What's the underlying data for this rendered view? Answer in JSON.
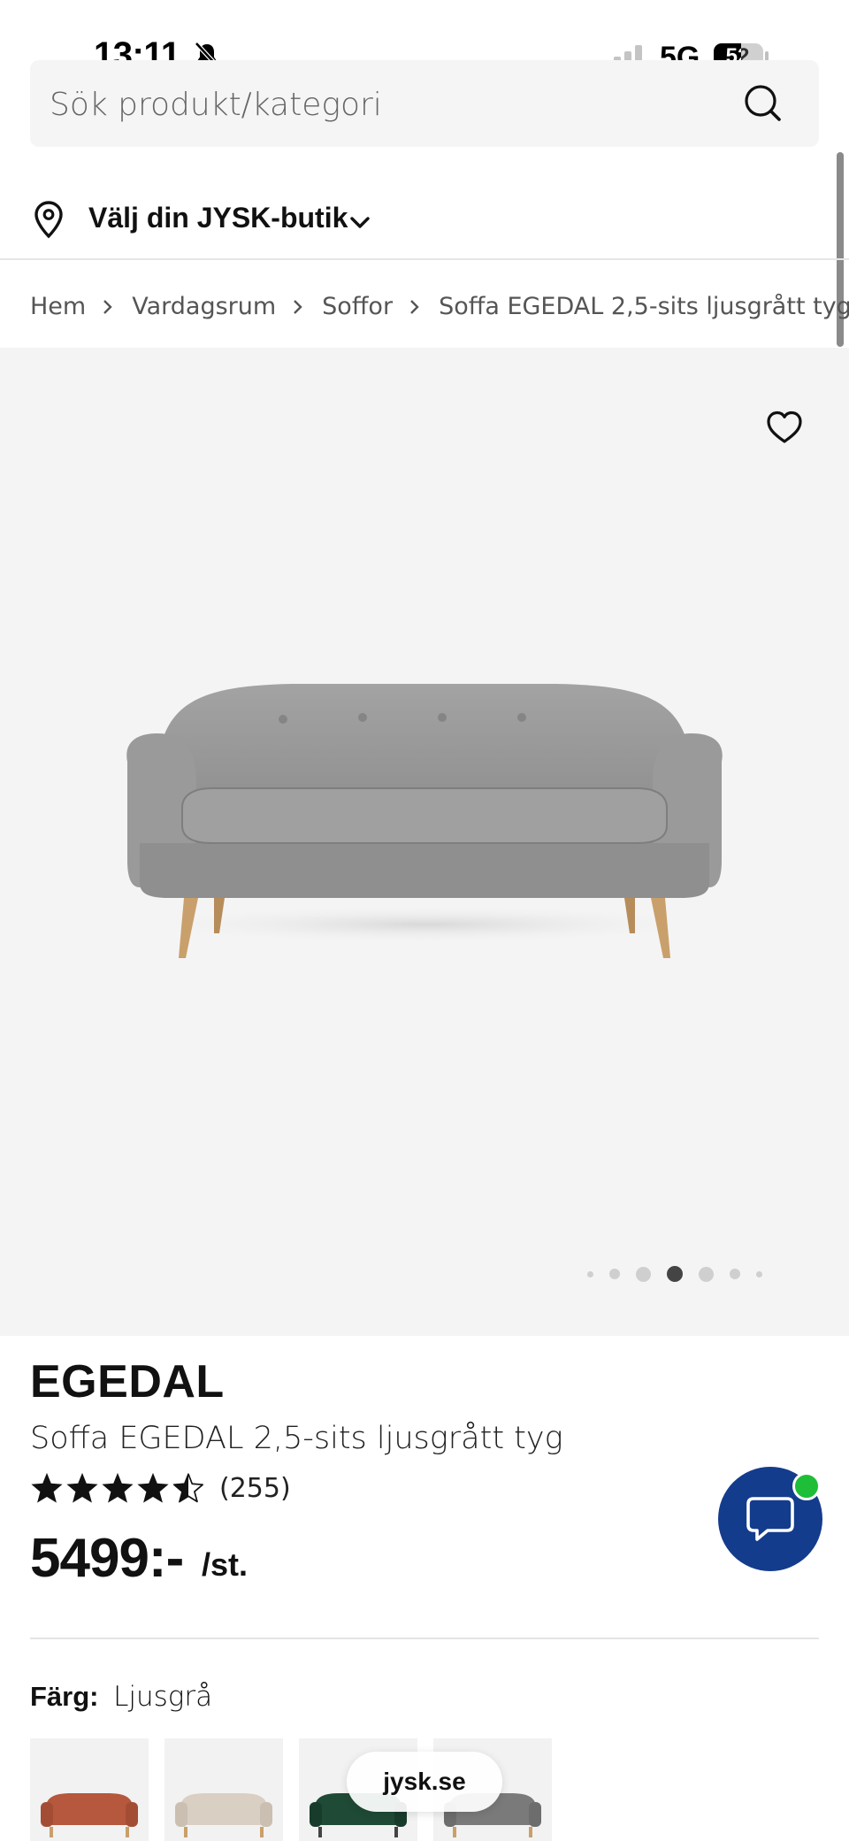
{
  "status_bar": {
    "time": "13:11",
    "network": "5G",
    "battery": "52"
  },
  "search": {
    "placeholder": "Sök produkt/kategori"
  },
  "store": {
    "label": "Välj din JYSK-butik"
  },
  "breadcrumb": [
    "Hem",
    "Vardagsrum",
    "Soffor",
    "Soffa EGEDAL 2,5-sits ljusgrått tyg"
  ],
  "gallery": {
    "total_images": 7,
    "active_index": 3
  },
  "product": {
    "brand": "EGEDAL",
    "name": "Soffa EGEDAL 2,5-sits ljusgrått tyg",
    "rating": 4.5,
    "review_count": "(255)",
    "price": "5499:-",
    "price_unit": "/st."
  },
  "color": {
    "label": "Färg:",
    "value": "Ljusgrå"
  },
  "swatches": [
    {
      "name": "rust",
      "color": "#b5583e"
    },
    {
      "name": "beige",
      "color": "#d9cfc3"
    },
    {
      "name": "green",
      "color": "#1f4a36"
    },
    {
      "name": "grey",
      "color": "#7a7a7a"
    }
  ],
  "browser": {
    "url": "jysk.se"
  },
  "colors": {
    "brand_blue": "#143c8c",
    "online_green": "#1ebe38",
    "image_bg": "#f4f4f4"
  }
}
